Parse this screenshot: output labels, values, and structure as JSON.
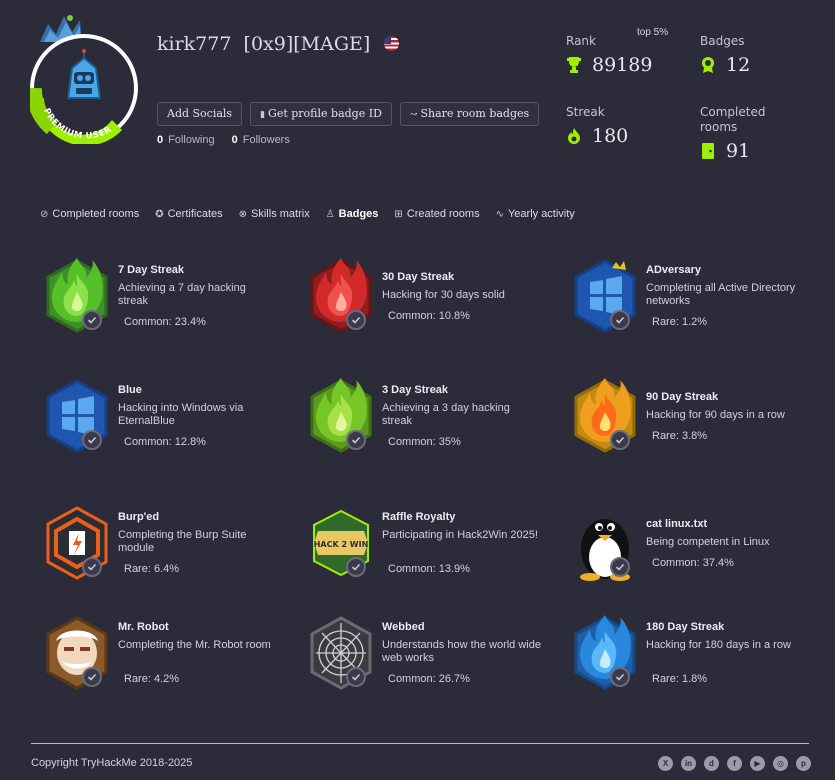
{
  "profile": {
    "username": "kirk777",
    "tag": "[0x9][MAGE]",
    "avatar_ribbon": "PREMIUM USER",
    "buttons": {
      "add_socials": "Add Socials",
      "profile_badge": "Get profile badge ID",
      "share_badges": "Share room badges"
    },
    "following_count": "0",
    "following_label": "Following",
    "followers_count": "0",
    "followers_label": "Followers"
  },
  "stats": {
    "rank_label": "Rank",
    "rank_value": "89189",
    "rank_note": "top 5%",
    "badges_label": "Badges",
    "badges_value": "12",
    "streak_label": "Streak",
    "streak_value": "180",
    "completed_label": "Completed rooms",
    "completed_value": "91",
    "accent": "#9fef00"
  },
  "tabs": [
    {
      "label": "Completed rooms",
      "icon": "check-circle-icon"
    },
    {
      "label": "Certificates",
      "icon": "certificate-icon"
    },
    {
      "label": "Skills matrix",
      "icon": "skills-icon"
    },
    {
      "label": "Badges",
      "icon": "badge-icon",
      "active": true
    },
    {
      "label": "Created rooms",
      "icon": "grid-icon"
    },
    {
      "label": "Yearly activity",
      "icon": "activity-icon"
    }
  ],
  "badges": [
    {
      "name": "7 Day Streak",
      "desc": "Achieving a 7 day hacking streak",
      "rarity": "Common: 23.4%",
      "art": "flame-green"
    },
    {
      "name": "30 Day Streak",
      "desc": "Hacking for 30 days solid",
      "rarity": "Common: 10.8%",
      "art": "flame-red"
    },
    {
      "name": "ADversary",
      "desc": "Completing all Active Directory networks",
      "rarity": "Rare: 1.2%",
      "art": "windows-crown"
    },
    {
      "name": "Blue",
      "desc": "Hacking into Windows via EternalBlue",
      "rarity": "Common: 12.8%",
      "art": "windows-blue"
    },
    {
      "name": "3 Day Streak",
      "desc": "Achieving a 3 day hacking streak",
      "rarity": "Common: 35%",
      "art": "flame-lime"
    },
    {
      "name": "90 Day Streak",
      "desc": "Hacking for 90 days in a row",
      "rarity": "Rare: 3.8%",
      "art": "flame-orange"
    },
    {
      "name": "Burp'ed",
      "desc": "Completing the Burp Suite module",
      "rarity": "Rare: 6.4%",
      "art": "burp"
    },
    {
      "name": "Raffle Royalty",
      "desc": "Participating in Hack2Win 2025!",
      "rarity": "Common: 13.9%",
      "art": "hack2win",
      "art_text": "HACK 2 WIN"
    },
    {
      "name": "cat linux.txt",
      "desc": "Being competent in Linux",
      "rarity": "Common: 37.4%",
      "art": "tux"
    },
    {
      "name": "Mr. Robot",
      "desc": "Completing the Mr. Robot room",
      "rarity": "Rare: 4.2%",
      "art": "mrrobot"
    },
    {
      "name": "Webbed",
      "desc": "Understands how the world wide web works",
      "rarity": "Common: 26.7%",
      "art": "web"
    },
    {
      "name": "180 Day Streak",
      "desc": "Hacking for 180 days in a row",
      "rarity": "Rare: 1.8%",
      "art": "flame-blue"
    }
  ],
  "footer": {
    "copyright": "Copyright TryHackMe 2018-2025",
    "socials": [
      {
        "icon": "x-icon",
        "glyph": "X"
      },
      {
        "icon": "linkedin-icon",
        "glyph": "in"
      },
      {
        "icon": "discord-icon",
        "glyph": "d"
      },
      {
        "icon": "facebook-icon",
        "glyph": "f"
      },
      {
        "icon": "youtube-icon",
        "glyph": "▶"
      },
      {
        "icon": "instagram-icon",
        "glyph": "◎"
      },
      {
        "icon": "pinterest-icon",
        "glyph": "p"
      }
    ]
  }
}
